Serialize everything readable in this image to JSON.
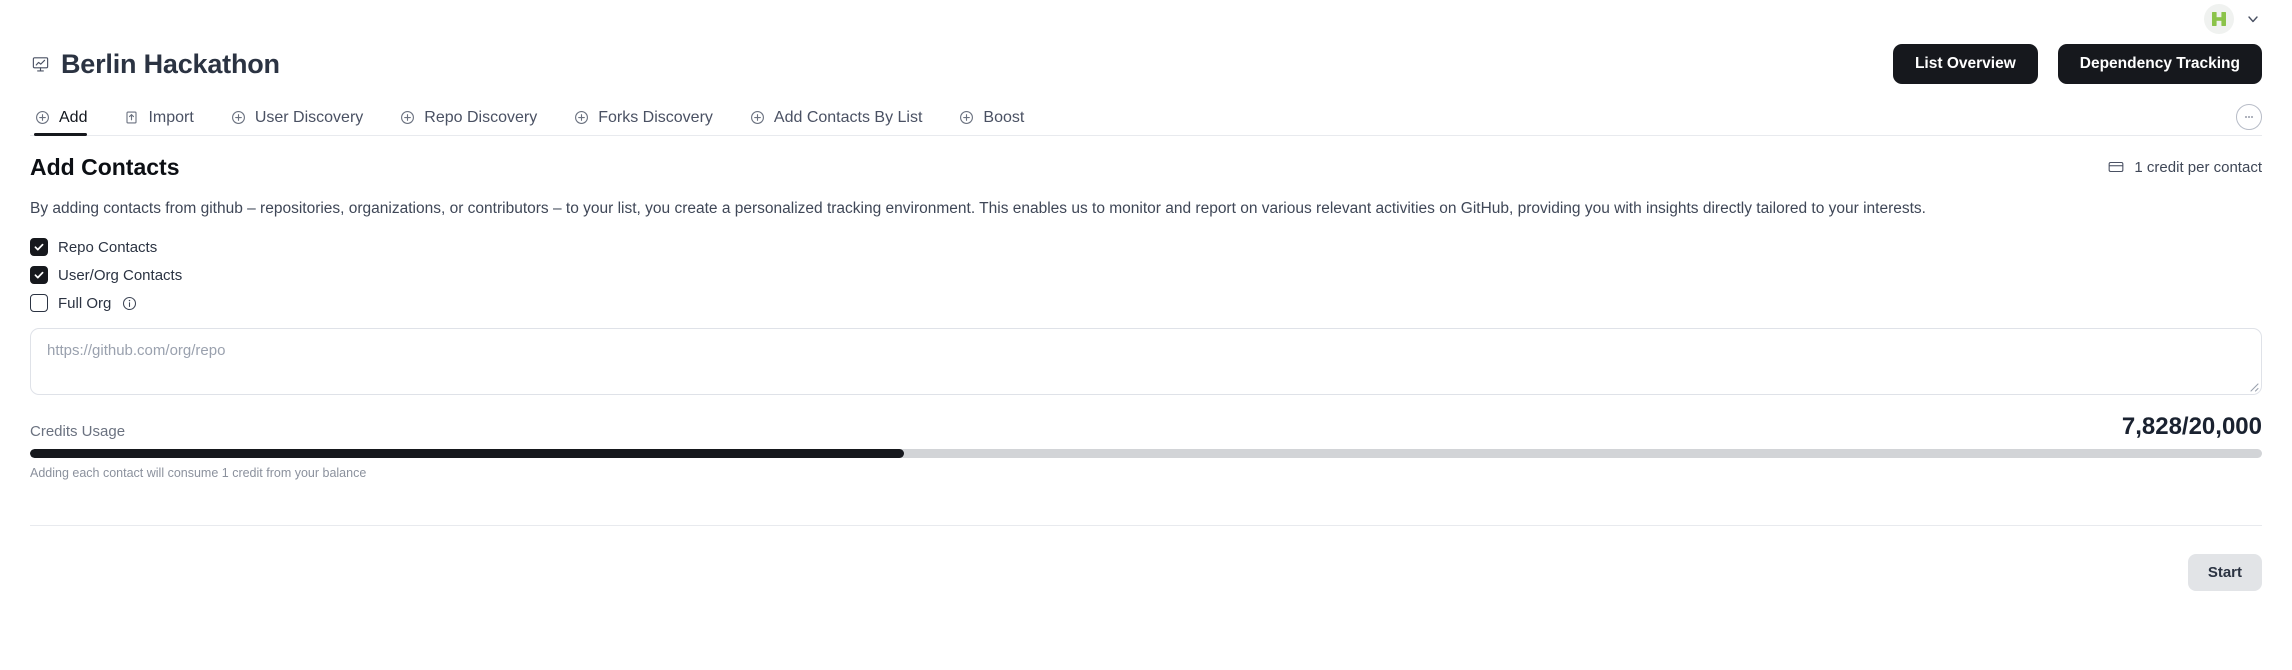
{
  "account": {
    "avatar_icon": "h-logo-avatar",
    "avatar_color": "#8bc34a",
    "avatar_bg": "#f0f2f0",
    "menu_icon": "chevron-down-icon"
  },
  "header": {
    "title": "Berlin Hackathon",
    "title_icon": "presentation-chart-icon",
    "actions": [
      {
        "label": "List Overview",
        "name": "list-overview-button"
      },
      {
        "label": "Dependency Tracking",
        "name": "dependency-tracking-button"
      }
    ]
  },
  "tabs": {
    "more_icon": "ellipsis-circle-icon",
    "items": [
      {
        "label": "Add",
        "icon": "plus-circle-icon",
        "active": true
      },
      {
        "label": "Import",
        "icon": "upload-icon",
        "active": false
      },
      {
        "label": "User Discovery",
        "icon": "plus-circle-icon",
        "active": false
      },
      {
        "label": "Repo Discovery",
        "icon": "plus-circle-icon",
        "active": false
      },
      {
        "label": "Forks Discovery",
        "icon": "plus-circle-icon",
        "active": false
      },
      {
        "label": "Add Contacts By List",
        "icon": "plus-circle-icon",
        "active": false
      },
      {
        "label": "Boost",
        "icon": "plus-circle-icon",
        "active": false
      }
    ]
  },
  "section": {
    "title": "Add Contacts",
    "credit_note": "1 credit per contact",
    "credit_icon": "credit-card-icon",
    "description": "By adding contacts from github – repositories, organizations, or contributors – to your list, you create a personalized tracking environment. This enables us to monitor and report on various relevant activities on GitHub, providing you with insights directly tailored to your interests."
  },
  "options": [
    {
      "label": "Repo Contacts",
      "checked": true,
      "name": "checkbox-repo-contacts",
      "info": false
    },
    {
      "label": "User/Org Contacts",
      "checked": true,
      "name": "checkbox-user-org-contacts",
      "info": false
    },
    {
      "label": "Full Org",
      "checked": false,
      "name": "checkbox-full-org",
      "info": true,
      "info_icon": "info-circle-icon"
    }
  ],
  "repo_input": {
    "value": "",
    "placeholder": "https://github.com/org/repo"
  },
  "credits": {
    "label": "Credits Usage",
    "value_text": "7,828/20,000",
    "used": 7828,
    "total": 20000,
    "percent": 39.14,
    "hint": "Adding each contact will consume 1 credit from your balance",
    "fill_color": "#16181d",
    "track_color": "#d2d4d7"
  },
  "footer": {
    "start_label": "Start"
  }
}
